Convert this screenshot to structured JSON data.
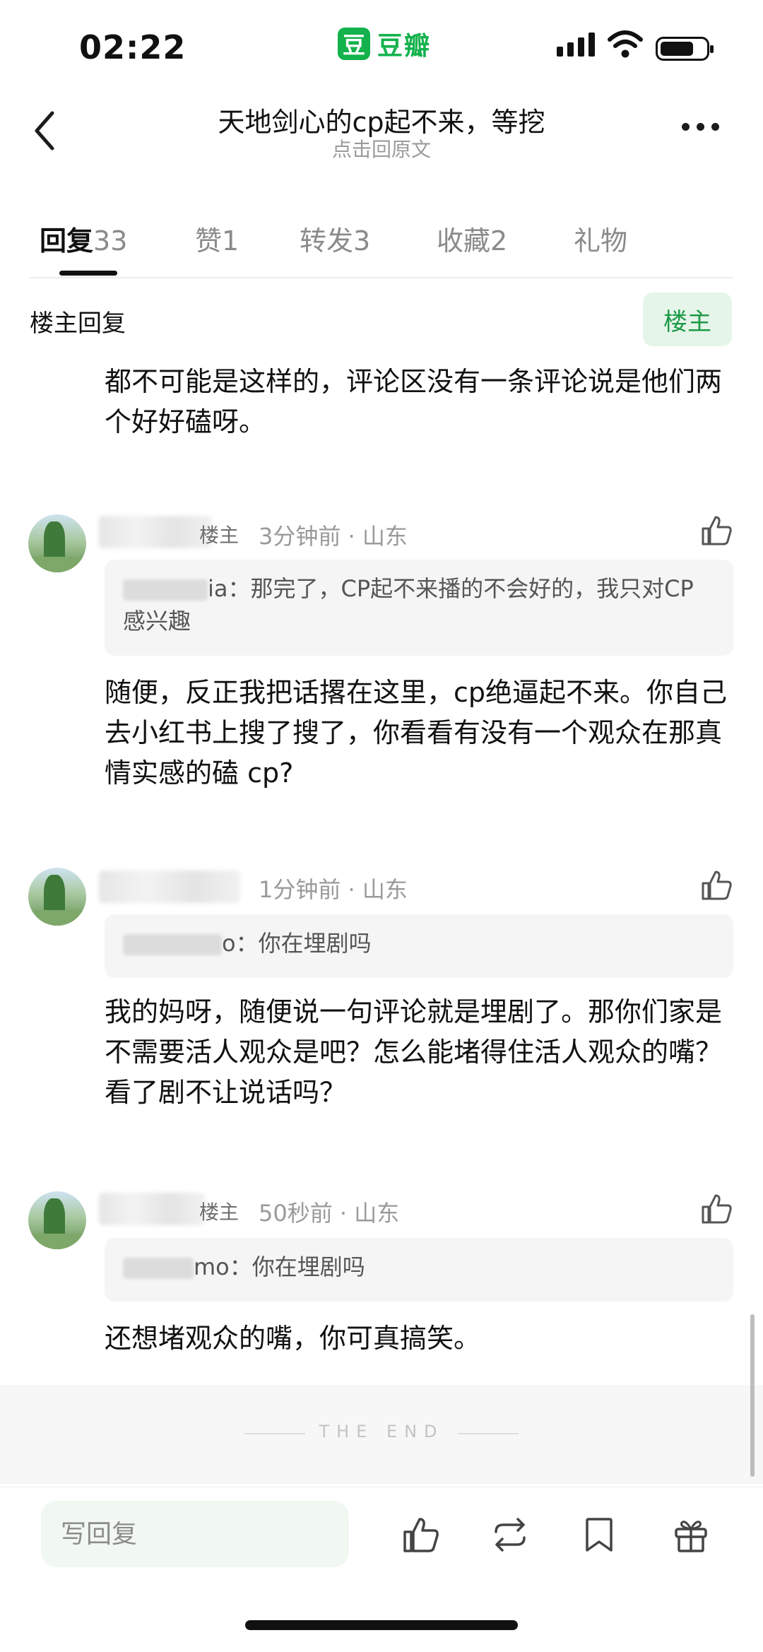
{
  "status_bar": {
    "time": "02:22",
    "app_logo_char": "豆",
    "app_name": "豆瓣"
  },
  "header": {
    "title": "天地剑心的cp起不来，等挖",
    "subtitle": "点击回原文"
  },
  "tabs": [
    {
      "label": "回复",
      "count": "33"
    },
    {
      "label": "赞",
      "count": "1"
    },
    {
      "label": "转发",
      "count": "3"
    },
    {
      "label": "收藏",
      "count": "2"
    },
    {
      "label": "礼物",
      "count": ""
    }
  ],
  "owner_section": {
    "title": "楼主回复",
    "owner_button": "楼主",
    "content": "都不可能是这样的，评论区没有一条评论说是他们两个好好磕呀。"
  },
  "comments": [
    {
      "badge": "楼主",
      "time": "3分钟前",
      "location": "山东",
      "quote_name_suffix": "ia：",
      "quote_text": "那完了，CP起不来播的不会好的，我只对CP感兴趣",
      "content": "随便，反正我把话撂在这里，cp绝逼起不来。你自己去小红书上搜了搜了，你看看有没有一个观众在那真情实感的磕 cp?"
    },
    {
      "badge": "",
      "time": "1分钟前",
      "location": "山东",
      "quote_name_suffix": "o：",
      "quote_text": "你在埋剧吗",
      "content": "我的妈呀，随便说一句评论就是埋剧了。那你们家是不需要活人观众是吧？怎么能堵得住活人观众的嘴？看了剧不让说话吗？"
    },
    {
      "badge": "楼主",
      "time": "50秒前",
      "location": "山东",
      "quote_name_suffix": "mo：",
      "quote_text": "你在埋剧吗",
      "content": "还想堵观众的嘴，你可真搞笑。"
    }
  ],
  "end_text": "THE END",
  "bottom_bar": {
    "reply_placeholder": "写回复"
  },
  "colors": {
    "brand_green": "#13b24c",
    "owner_green": "#1c9a47",
    "owner_bg": "#e6f5e9"
  }
}
